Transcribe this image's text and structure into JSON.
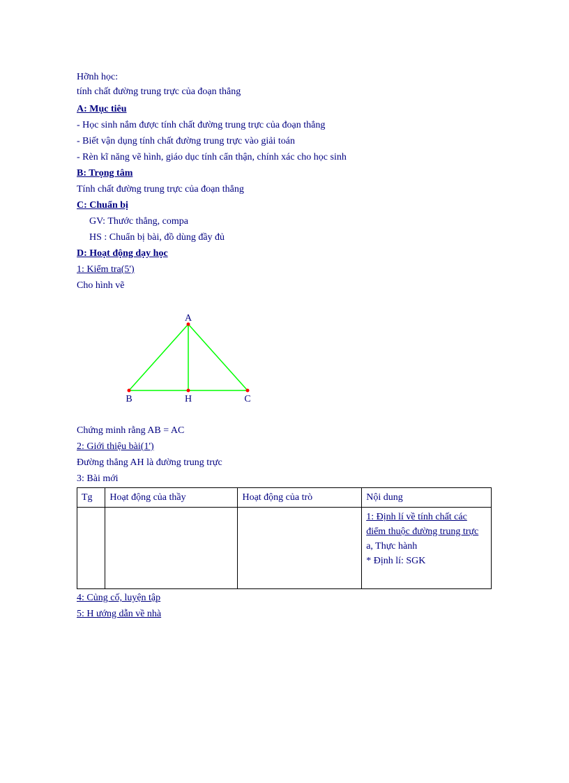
{
  "doc": {
    "title1": "Hỡnh học:",
    "title2": "tính chất đường trung trực của đoạn thẳng",
    "sectionA": "A: Mục tiêu",
    "a1": "- Học sinh nắm được tính chất đường trung trực của đoạn thẳng",
    "a2": "- Biết vận dụng tính chất đường trung trực vào giải toán",
    "a3": "- Rèn kĩ năng vẽ hình, giáo dục tính cẩn thận, chính xác cho học sinh",
    "sectionB": "B: Trọng tâm",
    "b1": " Tính chất đường trung trực của đoạn thẳng",
    "sectionC": "C: Chuẩn bị",
    "c1": "GV: Thước thẳng, compa",
    "c2": "HS : Chuẩn bị bài, đồ dùng đầy đủ",
    "sectionD": "D: Hoạt động dạy học",
    "d1": "1: Kiểm tra(5')",
    "d1a": " Cho hình vẽ",
    "diagram": {
      "A": "A",
      "B": "B",
      "H": "H",
      "C": "C"
    },
    "d1b": " Chứng minh rằng AB = AC",
    "d2": "2: Giới thiệu bài(1')",
    "d2a": " Đường thẳng AH là đường trung trực",
    "d3": "3: Bài mới",
    "table": {
      "h1": "Tg",
      "h2": "Hoạt động của thầy",
      "h3": "Hoạt động của trò",
      "h4": "Nội dung",
      "nd1": "1: Định lí về tính chất các điểm thuộc đường trung trực",
      "nd2": "a, Thực hành",
      "nd3": "* Định lí: SGK"
    },
    "d4": "4: Củng cố, luyện tập",
    "d5": "5: H  ướng dẫn về nhà"
  }
}
